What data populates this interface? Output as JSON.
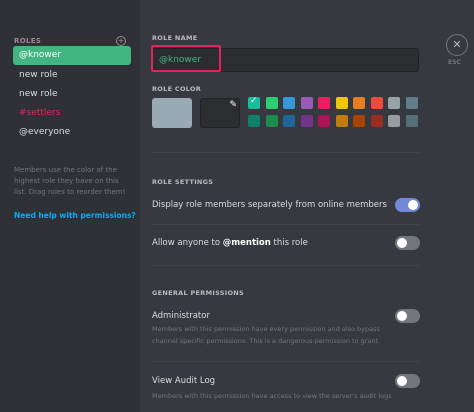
{
  "sidebar": {
    "title": "ROLES",
    "add_icon": "plus-circle-icon",
    "roles": [
      {
        "label": "@knower",
        "selected": true,
        "color": "#ffffff"
      },
      {
        "label": "new role",
        "selected": false,
        "color": "#dcddde"
      },
      {
        "label": "new role",
        "selected": false,
        "color": "#dcddde"
      },
      {
        "label": "#settlers",
        "selected": false,
        "color": "#e0245e"
      },
      {
        "label": "@everyone",
        "selected": false,
        "color": "#dcddde"
      }
    ],
    "help_text": "Members use the color of the highest role they have on this list. Drag roles to reorder them!",
    "help_link": "Need help with permissions?"
  },
  "header": {
    "close_icon": "close-icon",
    "esc_label": "ESC"
  },
  "role_name": {
    "title": "ROLE NAME",
    "value": "@knower"
  },
  "role_color": {
    "title": "ROLE COLOR",
    "default_color": "#99aab5",
    "dropper_icon": "eyedropper-icon",
    "swatches_row1": [
      "#1abc9c",
      "#2ecc71",
      "#3498db",
      "#9b59b6",
      "#e91e63",
      "#f1c40f",
      "#e67e22",
      "#e74c3c",
      "#95a5a6",
      "#607d8b"
    ],
    "swatches_row2": [
      "#11806a",
      "#1f8b4c",
      "#206694",
      "#71368a",
      "#ad1457",
      "#c27c0e",
      "#a84300",
      "#992d22",
      "#979c9f",
      "#546e7a"
    ],
    "selected_swatch": 0
  },
  "role_settings": {
    "title": "ROLE SETTINGS",
    "display_separately": {
      "label": "Display role members separately from online members",
      "on": true
    },
    "allow_mention": {
      "prefix": "Allow anyone to ",
      "bold": "@mention",
      "suffix": " this role",
      "on": false
    }
  },
  "general_permissions": {
    "title": "GENERAL PERMISSIONS",
    "administrator": {
      "label": "Administrator",
      "description": "Members with this permission have every permission and also bypass channel specific permissions. This is a dangerous permission to grant.",
      "on": false
    },
    "view_audit_log": {
      "label": "View Audit Log",
      "description": "Members with this permission have access to view the server's audit logs",
      "on": false
    }
  },
  "colors": {
    "accent_green": "#43b581",
    "toggle_on": "#7289da",
    "link": "#00b0f4",
    "highlight_border": "#e0245e"
  }
}
